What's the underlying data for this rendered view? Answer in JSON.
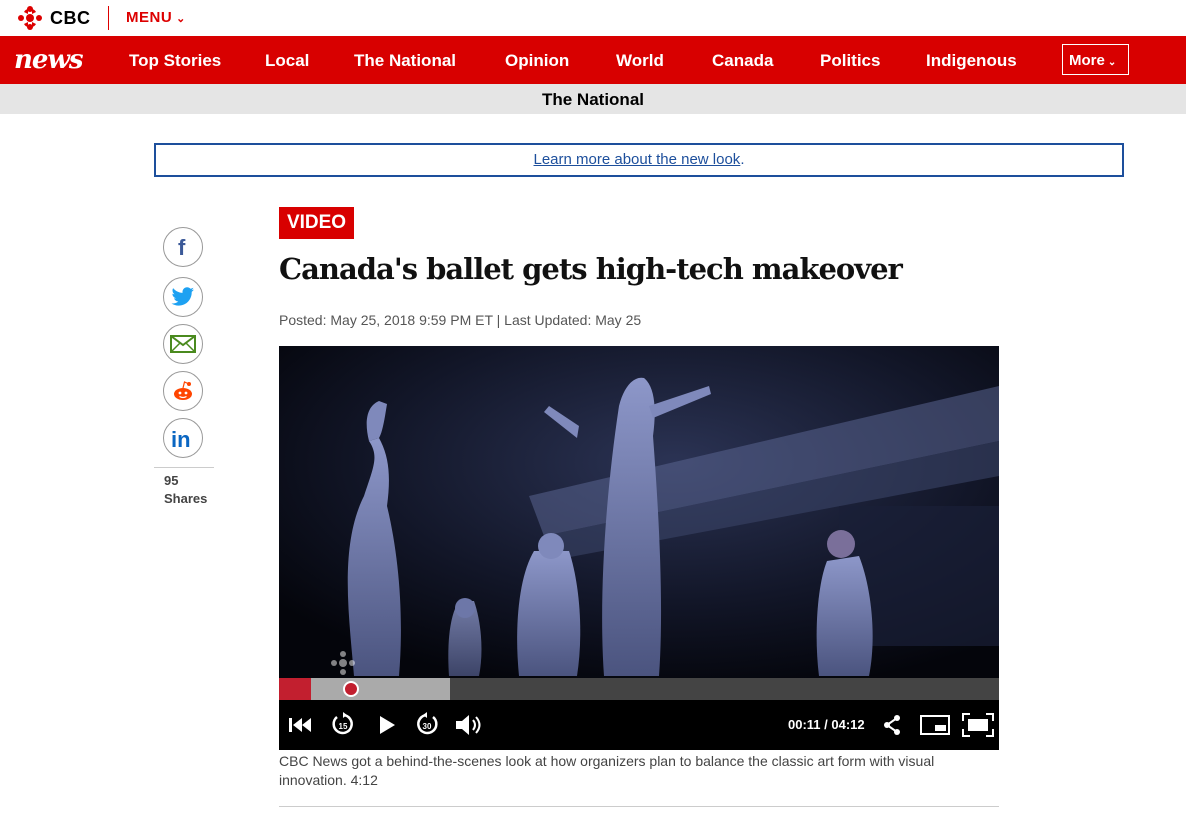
{
  "brand": {
    "name": "CBC",
    "menu_label": "MENU",
    "news_label": "news"
  },
  "nav": {
    "items": [
      {
        "label": "Top Stories"
      },
      {
        "label": "Local"
      },
      {
        "label": "The National"
      },
      {
        "label": "Opinion"
      },
      {
        "label": "World"
      },
      {
        "label": "Canada"
      },
      {
        "label": "Politics"
      },
      {
        "label": "Indigenous"
      }
    ],
    "more_label": "More"
  },
  "section": {
    "title": "The National"
  },
  "banner": {
    "link_text": "Learn more about the new look",
    "suffix": "."
  },
  "share": {
    "icons": [
      "facebook-icon",
      "twitter-icon",
      "email-icon",
      "reddit-icon",
      "linkedin-icon"
    ],
    "count": "95",
    "label": "Shares"
  },
  "article": {
    "tag": "VIDEO",
    "headline": "Canada's ballet gets high-tech makeover",
    "byline": "Posted: May 25, 2018 9:59 PM ET | Last Updated: May 25",
    "caption": "CBC News got a behind-the-scenes look at how organizers plan to balance the classic art form with visual innovation. 4:12"
  },
  "player": {
    "time_display": "00:11 / 04:12",
    "played_fraction": 0.044,
    "buffered_fraction": 0.237,
    "controls": [
      "rewind-icon",
      "skip-back-15-icon",
      "play-icon",
      "skip-forward-30-icon",
      "volume-icon",
      "share-icon",
      "picture-in-picture-icon",
      "fullscreen-icon"
    ]
  },
  "colors": {
    "brand_red": "#d80000",
    "link_blue": "#1d4f9c",
    "progress_red": "#c21f2f"
  }
}
